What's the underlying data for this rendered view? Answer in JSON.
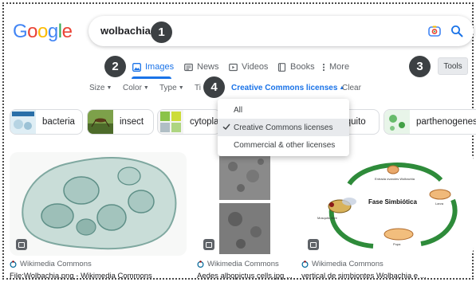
{
  "search": {
    "query": "wolbachia"
  },
  "logo": {
    "letters": [
      "G",
      "o",
      "o",
      "g",
      "l",
      "e"
    ],
    "colors": [
      "#4285F4",
      "#EA4335",
      "#FBBC05",
      "#4285F4",
      "#34A853",
      "#EA4335"
    ]
  },
  "badges": [
    "1",
    "2",
    "3",
    "4"
  ],
  "tabs": [
    {
      "label": "Images",
      "active": true
    },
    {
      "label": "News"
    },
    {
      "label": "Videos"
    },
    {
      "label": "Books"
    },
    {
      "label": "More"
    }
  ],
  "tools_label": "Tools",
  "filters": {
    "size": "Size",
    "color": "Color",
    "type": "Type",
    "time_partial": "Ti",
    "license": "Creative Commons licenses",
    "clear": "Clear"
  },
  "license_menu": {
    "items": [
      "All",
      "Creative Commons licenses",
      "Commercial & other licenses"
    ],
    "selected_index": 1
  },
  "chips": [
    {
      "label": "bacteria"
    },
    {
      "label": "insect"
    },
    {
      "label": "cytoplas"
    },
    {
      "label": "squito"
    },
    {
      "label": "parthenogenesis"
    }
  ],
  "results": [
    {
      "source": "Wikimedia Commons",
      "title": "File:Wolbachia.png - Wikimedia Commons"
    },
    {
      "source": "Wikimedia Commons",
      "title": "Aedes albopictus cells.jpg ..."
    },
    {
      "source": "Wikimedia Commons",
      "title": "vertical de simbiontes Wolbachia e ..."
    }
  ],
  "diagram_text": {
    "center": "Fase Simbiótica",
    "top": "Entrada ovaroles Wolbachia",
    "right": "Larva",
    "bottom": "Pupa",
    "left": "Mosquito libre"
  },
  "colors": {
    "accent": "#1a73e8",
    "badge": "#3c4043"
  }
}
